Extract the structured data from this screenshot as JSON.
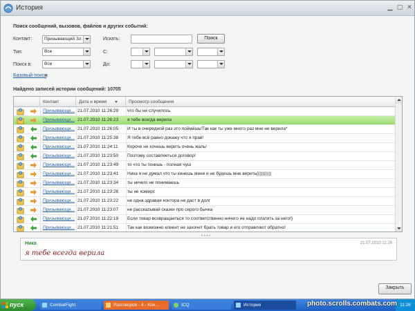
{
  "window": {
    "title": "История"
  },
  "search": {
    "section_title": "Поиск сообщений, вызовов, файлов и других событий:",
    "contact_label": "Контакт:",
    "contact_value": "Призывающий Зл",
    "search_label": "Искать:",
    "search_value": "",
    "search_button": "Поиск",
    "type_label": "Тип:",
    "type_value": "Все",
    "from_label": "С:",
    "searchin_label": "Поиск в:",
    "searchin_value": "Все",
    "to_label": "До:",
    "basic_search_link": "Базовый поиск",
    "basic_search_suffix": "я"
  },
  "results": {
    "count_text": "Найдено записей истории сообщений: 10705"
  },
  "grid": {
    "columns": {
      "contact": "Контакт",
      "datetime": "Дата и время",
      "message": "Просмотр сообщения"
    },
    "rows": [
      {
        "dir": "out",
        "contact": "Призывающи...",
        "datetime": "21.07.2010 11:26:29",
        "message": "что бы не случилось",
        "selected": false
      },
      {
        "dir": "out",
        "contact": "Призывающи...",
        "datetime": "21.07.2010 11:26:23",
        "message": "я тебе всегда верила",
        "selected": true
      },
      {
        "dir": "in",
        "contact": "Призывающи...",
        "datetime": "21.07.2010 11:26:05",
        "message": "И ты в очередной раз это поймёшь!Так как ты уже много раз мне не верила*",
        "selected": false
      },
      {
        "dir": "in",
        "contact": "Призывающи...",
        "datetime": "21.07.2010 11:25:38",
        "message": "Я тебе всё равно докажу что я прав!",
        "selected": false
      },
      {
        "dir": "in",
        "contact": "Призывающи...",
        "datetime": "21.07.2010 11:24:11",
        "message": "Короче не хочешь верить очень жаль!",
        "selected": false
      },
      {
        "dir": "in",
        "contact": "Призывающи...",
        "datetime": "21.07.2010 11:23:50",
        "message": "Поэтому составляеться договор!",
        "selected": false
      },
      {
        "dir": "out",
        "contact": "Призывающи...",
        "datetime": "21.07.2010 11:23:49",
        "message": "то что ты гонишь - полная чуш",
        "selected": false
      },
      {
        "dir": "out",
        "contact": "Призывающи...",
        "datetime": "21.07.2010 11:23:41",
        "message": "Ника я не думал что ты кинешь меня и не будешь мне верить((((((((((",
        "selected": false
      },
      {
        "dir": "out",
        "contact": "Призывающи...",
        "datetime": "21.07.2010 11:23:34",
        "message": "ты ничего не понимаешь",
        "selected": false
      },
      {
        "dir": "out",
        "contact": "Призывающи...",
        "datetime": "21.07.2010 11:23:28",
        "message": "ты не комерс",
        "selected": false
      },
      {
        "dir": "out",
        "contact": "Призывающи...",
        "datetime": "21.07.2010 11:23:22",
        "message": "не одна здравая контора не даст в долг",
        "selected": false
      },
      {
        "dir": "out",
        "contact": "Призывающи...",
        "datetime": "21.07.2010 11:23:07",
        "message": "не расскazывай сказки про серого бычка",
        "selected": false
      },
      {
        "dir": "in",
        "contact": "Призывающи...",
        "datetime": "21.07.2010 11:22:19",
        "message": "Если товар возвращаеться то соответственно ничего не надо платить за него!)",
        "selected": false
      },
      {
        "dir": "in",
        "contact": "Призывающи...",
        "datetime": "21.07.2010 11:21:51",
        "message": "Так как возможно клиент не захочет брать товар и его отправляют обратно!",
        "selected": false
      }
    ]
  },
  "preview": {
    "name": "Ника",
    "time": "21.07.2010 11:26",
    "text": "я тебе всегда верила"
  },
  "footer": {
    "close_button": "Закрыть"
  },
  "taskbar": {
    "start_label": "пуск",
    "tasks": [
      {
        "label": "CombatFight"
      },
      {
        "label": "Разговоров - 4 - Кон..."
      },
      {
        "label": "ICQ"
      },
      {
        "label": "История"
      }
    ],
    "tray_time": "11:26"
  },
  "watermark": "photo.scrolls.combats.com",
  "colors": {
    "selected_row": "#9adb70",
    "link": "#1c5ca8",
    "preview_name": "#2f8a2f",
    "preview_text": "#8b1a1a",
    "taskbar": "#1e5fc4"
  },
  "icons": {
    "row_icon": "user-icon",
    "out_dir": "arrow-right-icon",
    "in_dir": "arrow-left-icon"
  }
}
